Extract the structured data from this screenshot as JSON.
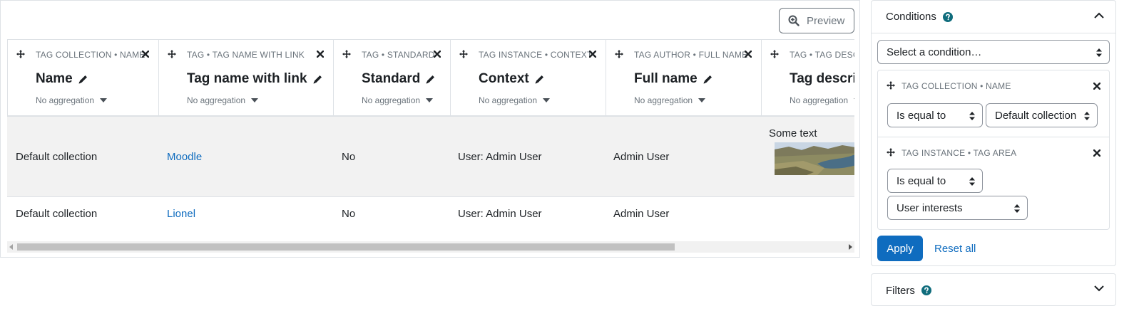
{
  "toolbar": {
    "preview_label": "Preview"
  },
  "columns": [
    {
      "sub": "TAG COLLECTION • NAME",
      "name": "Name",
      "agg": "No aggregation"
    },
    {
      "sub": "TAG • TAG NAME WITH LINK",
      "name": "Tag name with link",
      "agg": "No aggregation"
    },
    {
      "sub": "TAG • STANDARD",
      "name": "Standard",
      "agg": "No aggregation"
    },
    {
      "sub": "TAG INSTANCE • CONTEXT",
      "name": "Context",
      "agg": "No aggregation"
    },
    {
      "sub": "TAG AUTHOR • FULL NAME",
      "name": "Full name",
      "agg": "No aggregation"
    },
    {
      "sub": "TAG • TAG DESCRIPTION",
      "name": "Tag description",
      "agg": "No aggregation"
    }
  ],
  "rows": [
    {
      "collection": "Default collection",
      "tag": "Moodle",
      "standard": "No",
      "context": "User: Admin User",
      "fullname": "Admin User",
      "description": "Some text"
    },
    {
      "collection": "Default collection",
      "tag": "Lionel",
      "standard": "No",
      "context": "User: Admin User",
      "fullname": "Admin User",
      "description": ""
    }
  ],
  "conditions": {
    "title": "Conditions",
    "select_placeholder": "Select a condition…",
    "items": [
      {
        "sub": "TAG COLLECTION • NAME",
        "operator": "Is equal to",
        "value": "Default collection"
      },
      {
        "sub": "TAG INSTANCE • TAG AREA",
        "operator": "Is equal to",
        "value": "User interests"
      }
    ],
    "apply_label": "Apply",
    "reset_label": "Reset all"
  },
  "filters": {
    "title": "Filters"
  },
  "colors": {
    "accent": "#0f6cbf",
    "help": "#0f6c7c",
    "muted": "#6a737b"
  }
}
